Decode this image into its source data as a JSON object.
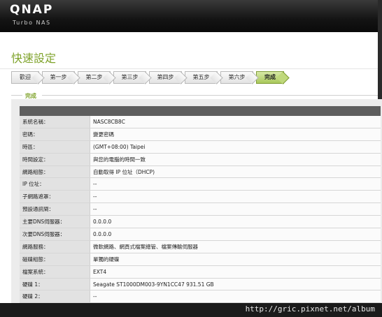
{
  "header": {
    "logo": "QNAP",
    "subtitle": "Turbo NAS"
  },
  "page": {
    "title": "快速設定",
    "section_label": "完成"
  },
  "steps": [
    {
      "label": "歡迎"
    },
    {
      "label": "第一步"
    },
    {
      "label": "第二步"
    },
    {
      "label": "第三步"
    },
    {
      "label": "第四步"
    },
    {
      "label": "第五步"
    },
    {
      "label": "第六步"
    },
    {
      "label": "完成",
      "active": true
    }
  ],
  "summary": [
    {
      "key": "系統名稱：",
      "value": "NASC8CB8C"
    },
    {
      "key": "密碼：",
      "value": "變更密碼"
    },
    {
      "key": "時區：",
      "value": "(GMT+08:00) Taipei"
    },
    {
      "key": "時間設定：",
      "value": "與您的電腦的時間一致"
    },
    {
      "key": "網路組態：",
      "value": "自動取得 IP 位址（DHCP)"
    },
    {
      "key": "IP 位址：",
      "value": "--"
    },
    {
      "key": "子網路遮罩：",
      "value": "--"
    },
    {
      "key": "預設通訊閘：",
      "value": "--"
    },
    {
      "key": "主要DNS伺服器：",
      "value": "0.0.0.0"
    },
    {
      "key": "次要DNS伺服器：",
      "value": "0.0.0.0"
    },
    {
      "key": "網路服務：",
      "value": "微軟網路、網頁式檔案總管、檔案傳輸伺服器"
    },
    {
      "key": "磁碟組態：",
      "value": "單獨的硬碟"
    },
    {
      "key": "檔案系統：",
      "value": "EXT4"
    },
    {
      "key": "硬碟 1：",
      "value": "Seagate ST1000DM003-9YN1CC47 931.51 GB"
    },
    {
      "key": "硬碟 2：",
      "value": "--"
    }
  ],
  "footer": {
    "url": "http://gric.pixnet.net/album"
  }
}
